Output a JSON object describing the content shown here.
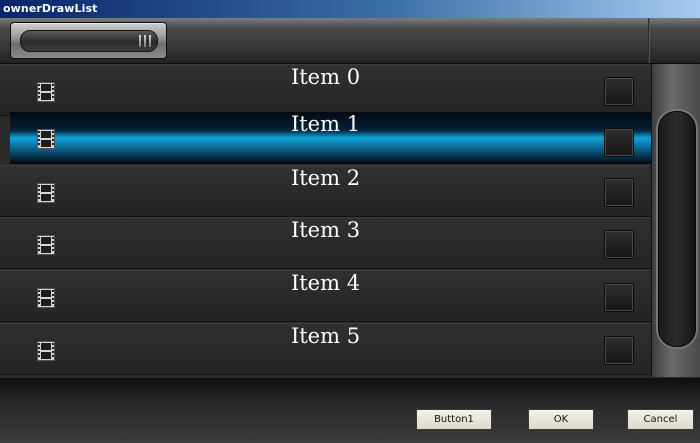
{
  "window": {
    "title": "ownerDrawList"
  },
  "list": {
    "items": [
      {
        "label": "Item 0",
        "selected": false,
        "icon": "film-icon"
      },
      {
        "label": "Item 1",
        "selected": true,
        "icon": "film-icon"
      },
      {
        "label": "Item 2",
        "selected": false,
        "icon": "film-icon"
      },
      {
        "label": "Item 3",
        "selected": false,
        "icon": "film-icon"
      },
      {
        "label": "Item 4",
        "selected": false,
        "icon": "film-icon"
      },
      {
        "label": "Item 5",
        "selected": false,
        "icon": "film-icon"
      }
    ]
  },
  "buttons": {
    "button1": "Button1",
    "ok": "OK",
    "cancel": "Cancel"
  },
  "colors": {
    "selection_accent": "#0ea4d6",
    "list_background": "#2b2b2b",
    "titlebar": "#0a246a"
  }
}
